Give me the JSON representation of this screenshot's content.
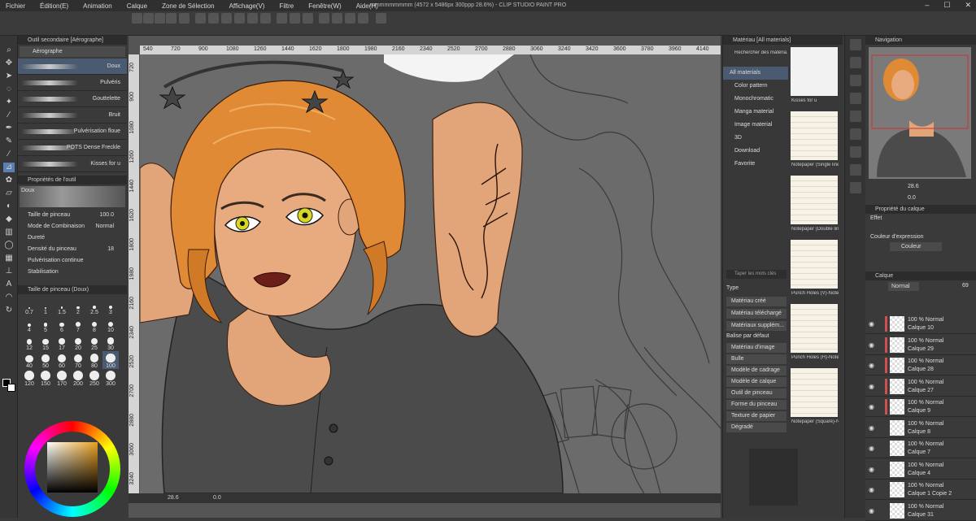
{
  "menu": {
    "items": [
      "Fichier",
      "Édition(E)",
      "Animation",
      "Calque",
      "Zone de Sélection",
      "Affichage(V)",
      "Filtre",
      "Fenêtre(W)",
      "Aide(H)"
    ],
    "window_title": "mmmmmmmmm (4572 x 5486px 300ppp 28.6%) - CLIP STUDIO PAINT PRO",
    "window_buttons": [
      "–",
      "☐",
      "✕"
    ]
  },
  "document_tab": "mmmmmmmmm",
  "subtool": {
    "panel_title": "Outil secondaire [Aérographe]",
    "group_tab": "Aérographe",
    "brushes": [
      "Doux",
      "Pulvéris",
      "Gouttelette",
      "Bruit",
      "Pulvérisation floue",
      "POTS Dense Freckle",
      "Kisses for u"
    ]
  },
  "tool_props": {
    "panel_title": "Propriétés de l'outil",
    "preset_name": "Doux",
    "rows": [
      {
        "label": "Taille de pinceau",
        "value": "100.0"
      },
      {
        "label": "Mode de Combinaison",
        "value": "Normal"
      },
      {
        "label": "Dureté",
        "value": ""
      },
      {
        "label": "Densité du pinceau",
        "value": "18"
      },
      {
        "label": "Pulvérisation continue",
        "value": ""
      },
      {
        "label": "Stabilisation",
        "value": ""
      }
    ]
  },
  "brush_size": {
    "panel_title": "Taille de pinceau (Doux)",
    "sizes": [
      "0.7",
      "1",
      "1.5",
      "2",
      "2.5",
      "3",
      "4",
      "5",
      "6",
      "7",
      "8",
      "10",
      "12",
      "15",
      "17",
      "20",
      "25",
      "30",
      "40",
      "50",
      "60",
      "70",
      "80",
      "100",
      "120",
      "150",
      "170",
      "200",
      "250",
      "300"
    ]
  },
  "ruler_ticks": [
    "540",
    "720",
    "900",
    "1080",
    "1260",
    "1440",
    "1620",
    "1800",
    "1980",
    "2160",
    "2340",
    "2520",
    "2700",
    "2880",
    "3060",
    "3240",
    "3420",
    "3600",
    "3780",
    "3960",
    "4140"
  ],
  "ruler_left_ticks": [
    "720",
    "900",
    "1080",
    "1260",
    "1440",
    "1620",
    "1800",
    "1980",
    "2160",
    "2340",
    "2520",
    "2700",
    "2880",
    "3060",
    "3240"
  ],
  "status": {
    "zoom": "28.6",
    "angle": "0.0"
  },
  "material": {
    "panel_title": "Matériau [All materials]",
    "search_btn": "Rechercher des matéria...",
    "tree": [
      "All materials",
      "Color pattern",
      "Monochromatic",
      "Manga material",
      "Image material",
      "3D",
      "Download",
      "Favorite"
    ],
    "search_placeholder": "Taper les mots clés",
    "type_label": "Type",
    "type_tags": [
      "Matériau créé",
      "Matériau téléchargé",
      "Matériaux supplém..."
    ],
    "balise_label": "Balise par défaut",
    "balise_tags": [
      "Matériau d'image",
      "Bulle",
      "Modèle de cadrage",
      "Modèle de calque",
      "Outil de pinceau",
      "Forme du pinceau",
      "Texture de papier",
      "Dégradé"
    ],
    "thumbs": [
      "Kisses for u",
      "Notepaper (Single line...",
      "Notepaper (Double line...",
      "Punch Holes (V)-Note...",
      "Punch Holes (H)-Note...",
      "Notepaper (Square)-N..."
    ]
  },
  "navigation": {
    "panel_title": "Navigation",
    "zoom": "28.6",
    "angle": "0.0"
  },
  "layer_props": {
    "panel_title": "Propriété du calque",
    "effect": "Effet",
    "expr_label": "Couleur d'expression",
    "expr_value": "Couleur"
  },
  "layers": {
    "panel_title": "Calque",
    "blend": "Normal",
    "opacity": "69",
    "items": [
      {
        "mode": "100 % Normal",
        "name": "Calque 10"
      },
      {
        "mode": "100 % Normal",
        "name": "Calque 29"
      },
      {
        "mode": "100 % Normal",
        "name": "Calque 28"
      },
      {
        "mode": "100 % Normal",
        "name": "Calque 27"
      },
      {
        "mode": "100 % Normal",
        "name": "Calque 9"
      },
      {
        "mode": "100 % Normal",
        "name": "Calque 8"
      },
      {
        "mode": "100 % Normal",
        "name": "Calque 7"
      },
      {
        "mode": "100 % Normal",
        "name": "Calque 4"
      },
      {
        "mode": "100 % Normal",
        "name": "Calque 1 Copie 2"
      },
      {
        "mode": "100 % Normal",
        "name": "Calque 31"
      }
    ]
  },
  "colors": {
    "accent": "#4a86c8",
    "skin": "#e2a57a",
    "hair": "#e08a35",
    "shirt": "#4b4b4b",
    "canvas_bg": "#6b6b6b"
  }
}
